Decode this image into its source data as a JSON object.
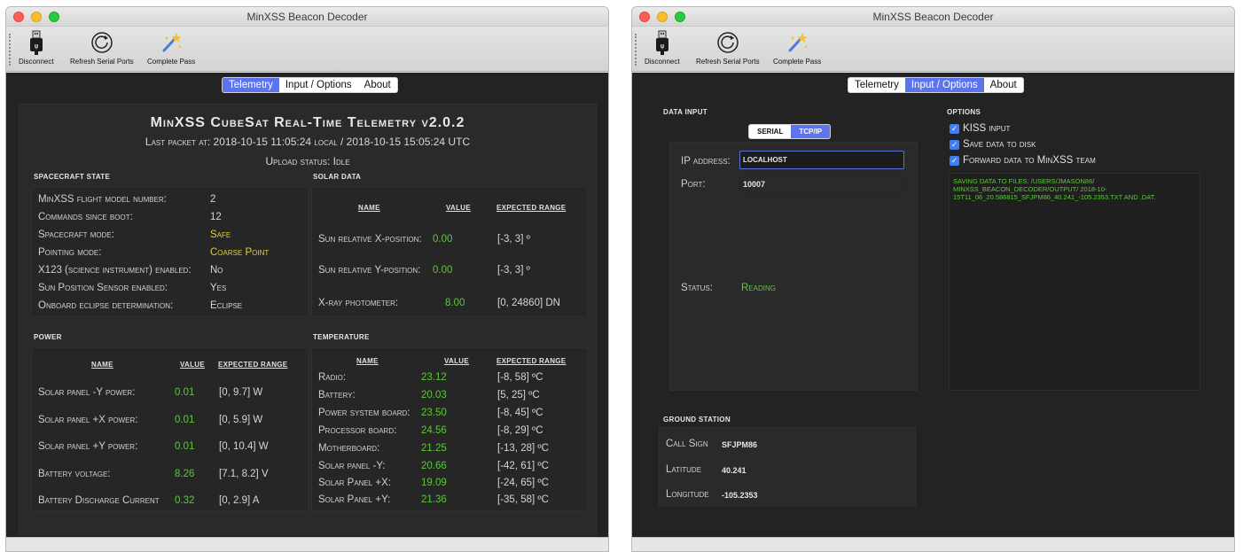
{
  "windows": {
    "left": {
      "title": "MinXSS Beacon Decoder",
      "toolbar": {
        "disconnect": "Disconnect",
        "refresh": "Refresh Serial Ports",
        "complete": "Complete Pass"
      },
      "tabs": [
        "Telemetry",
        "Input / Options",
        "About"
      ],
      "active_tab": "Telemetry",
      "telemetry": {
        "title": "MinXSS CubeSat Real-Time Telemetry v2.0.2",
        "last_packet": "Last packet at: 2018-10-15 11:05:24 local  /  2018-10-15 15:05:24 UTC",
        "upload_status": "Upload status: Idle",
        "spacecraft_state": {
          "header": "Spacecraft State",
          "rows": [
            {
              "label": "MinXSS flight model number:",
              "value": "2"
            },
            {
              "label": "Commands since boot:",
              "value": "12"
            },
            {
              "label": "Spacecraft mode:",
              "value": "Safe"
            },
            {
              "label": "Pointing mode:",
              "value": "Coarse Point"
            },
            {
              "label": "X123 (science instrument) enabled:",
              "value": "No"
            },
            {
              "label": "Sun Position Sensor enabled:",
              "value": "Yes"
            },
            {
              "label": "Onboard eclipse determination:",
              "value": "Eclipse"
            }
          ]
        },
        "solar_data": {
          "header": "Solar data",
          "col_name": "Name",
          "col_value": "Value",
          "col_range": "Expected range",
          "rows": [
            {
              "label": "Sun relative X-position:",
              "value": "0.00",
              "range": "[-3, 3] º"
            },
            {
              "label": "Sun relative Y-position:",
              "value": "0.00",
              "range": "[-3, 3] º"
            },
            {
              "label": "X-ray photometer:",
              "value": "8.00",
              "range": "[0, 24860] DN"
            }
          ]
        },
        "power": {
          "header": "Power",
          "col_name": "Name",
          "col_value": "Value",
          "col_range": "Expected range",
          "rows": [
            {
              "label": "Solar panel -Y power:",
              "value": "0.01",
              "range": "[0, 9.7] W"
            },
            {
              "label": "Solar panel +X power:",
              "value": "0.01",
              "range": "[0, 5.9] W"
            },
            {
              "label": "Solar panel +Y power:",
              "value": "0.01",
              "range": "[0, 10.4] W"
            },
            {
              "label": "Battery voltage:",
              "value": "8.26",
              "range": "[7.1, 8.2] V"
            },
            {
              "label": "Battery Discharge Current",
              "value": "0.32",
              "range": "[0, 2.9] A"
            }
          ]
        },
        "temperature": {
          "header": "Temperature",
          "col_name": "Name",
          "col_value": "Value",
          "col_range": "Expected range",
          "rows": [
            {
              "label": "Radio:",
              "value": "23.12",
              "range": "[-8, 58] ºC"
            },
            {
              "label": "Battery:",
              "value": "20.03",
              "range": "[5, 25] ºC"
            },
            {
              "label": "Power system board:",
              "value": "23.50",
              "range": "[-8, 45] ºC"
            },
            {
              "label": "Processor board:",
              "value": "24.56",
              "range": "[-8, 29] ºC"
            },
            {
              "label": "Motherboard:",
              "value": "21.25",
              "range": "[-13, 28] ºC"
            },
            {
              "label": "Solar panel -Y:",
              "value": "20.66",
              "range": "[-42, 61] ºC"
            },
            {
              "label": "Solar Panel +X:",
              "value": "19.09",
              "range": "[-24, 65] ºC"
            },
            {
              "label": "Solar Panel +Y:",
              "value": "21.36",
              "range": "[-35, 58] ºC"
            }
          ]
        }
      }
    },
    "right": {
      "title": "MinXSS Beacon Decoder",
      "toolbar": {
        "disconnect": "Disconnect",
        "refresh": "Refresh Serial Ports",
        "complete": "Complete Pass"
      },
      "tabs": [
        "Telemetry",
        "Input / Options",
        "About"
      ],
      "active_tab": "Input / Options",
      "data_input": {
        "header": "Data Input",
        "modes": [
          "Serial",
          "TCP/IP"
        ],
        "active_mode": "TCP/IP",
        "ip_label": "IP address:",
        "ip_value": "localhost",
        "port_label": "Port:",
        "port_value": "10007",
        "status_label": "Status:",
        "status_value": "Reading"
      },
      "ground_station": {
        "header": "Ground Station",
        "call_sign_label": "Call Sign",
        "call_sign_value": "SFJPM86",
        "latitude_label": "Latitude",
        "latitude_value": "40.241",
        "longitude_label": "Longitude",
        "longitude_value": "-105.2353"
      },
      "options": {
        "header": "Options",
        "kiss_input": "KISS input",
        "save_to_disk": "Save data to disk",
        "forward": "Forward data to MinXSS team",
        "log_text": "Saving data to files: /Users/jmason86/ MinXSS_Beacon_Decoder/output/ 2018-10-15T11_06_20.586815_SFJPM86_40.241_-105.2353.txt and .dat."
      }
    }
  },
  "colors": {
    "accent": "#5c74ee",
    "ok_green": "#5fc83a",
    "warn_yellow": "#e6cc3a",
    "panel_bg": "#232323"
  }
}
